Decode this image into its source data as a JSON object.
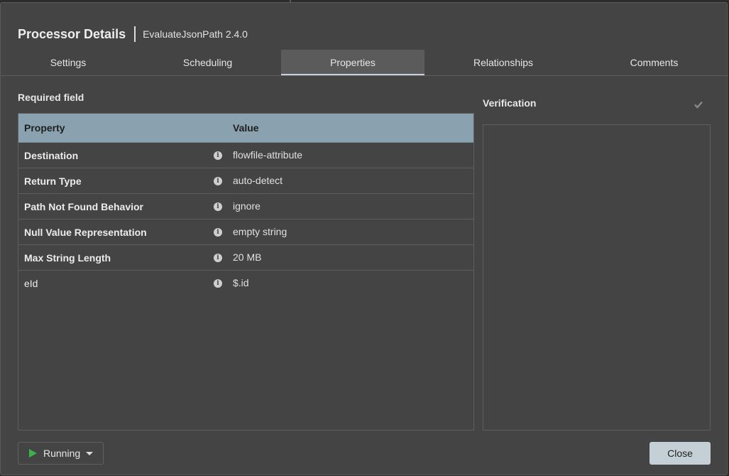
{
  "dialog": {
    "title": "Processor Details",
    "subtitle": "EvaluateJsonPath 2.4.0"
  },
  "tabs": [
    {
      "label": "Settings",
      "active": false
    },
    {
      "label": "Scheduling",
      "active": false
    },
    {
      "label": "Properties",
      "active": true
    },
    {
      "label": "Relationships",
      "active": false
    },
    {
      "label": "Comments",
      "active": false
    }
  ],
  "required_label": "Required field",
  "table": {
    "headers": {
      "property": "Property",
      "value": "Value"
    },
    "rows": [
      {
        "name": "Destination",
        "value": "flowfile-attribute",
        "required": true,
        "info_icon": "info-icon"
      },
      {
        "name": "Return Type",
        "value": "auto-detect",
        "required": true,
        "info_icon": "info-icon"
      },
      {
        "name": "Path Not Found Behavior",
        "value": "ignore",
        "required": true,
        "info_icon": "info-icon"
      },
      {
        "name": "Null Value Representation",
        "value": "empty string",
        "required": true,
        "info_icon": "info-icon"
      },
      {
        "name": "Max String Length",
        "value": "20 MB",
        "required": true,
        "info_icon": "info-icon"
      },
      {
        "name": "eId",
        "value": "$.id",
        "required": false,
        "info_icon": "info-icon"
      }
    ]
  },
  "verification": {
    "title": "Verification",
    "icon": "check-icon"
  },
  "footer": {
    "run_status": "Running",
    "run_icon": "play-icon",
    "close_label": "Close"
  },
  "colors": {
    "dialog_bg": "#444444",
    "header_bg": "#8aa2b0",
    "run_green": "#3cb34a",
    "close_bg": "#c4d0d6"
  }
}
